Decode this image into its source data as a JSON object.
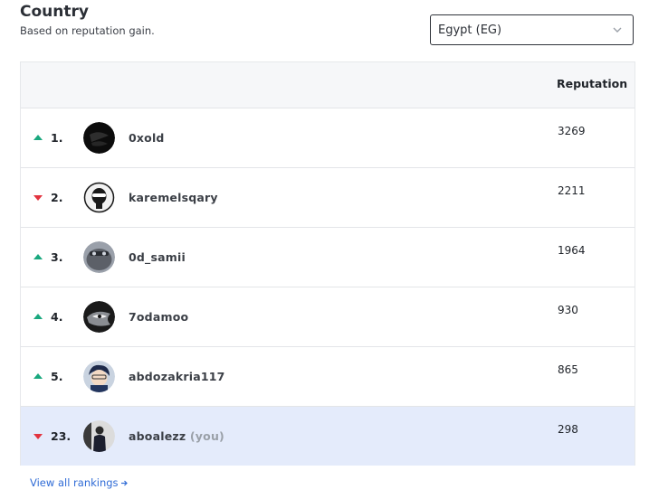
{
  "header": {
    "title": "Country",
    "subtitle": "Based on reputation gain."
  },
  "country_select": {
    "value": "Egypt (EG)",
    "icon": "chevron-down-icon"
  },
  "table": {
    "columns": {
      "reputation": "Reputation"
    },
    "rows": [
      {
        "trend": "up",
        "rank": "1.",
        "username": "0xold",
        "reputation": "3269",
        "you": false
      },
      {
        "trend": "down",
        "rank": "2.",
        "username": "karemelsqary",
        "reputation": "2211",
        "you": false
      },
      {
        "trend": "up",
        "rank": "3.",
        "username": "0d_samii",
        "reputation": "1964",
        "you": false
      },
      {
        "trend": "up",
        "rank": "4.",
        "username": "7odamoo",
        "reputation": "930",
        "you": false
      },
      {
        "trend": "up",
        "rank": "5.",
        "username": "abdozakria117",
        "reputation": "865",
        "you": false
      },
      {
        "trend": "down",
        "rank": "23.",
        "username": "aboalezz",
        "you_label": "(you)",
        "reputation": "298",
        "you": true
      }
    ]
  },
  "footer": {
    "view_all": "View all rankings"
  },
  "colors": {
    "up": "#1aa87e",
    "down": "#e2333f",
    "highlight": "#e4ebfb",
    "link": "#2f6bd6"
  }
}
